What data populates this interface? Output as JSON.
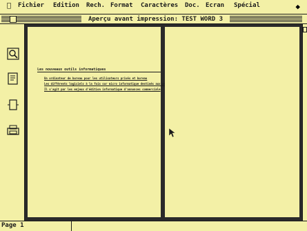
{
  "menubar": {
    "apple_icon": "apple-icon",
    "items": [
      "Fichier",
      "Edition",
      "Rech.",
      "Format",
      "Caractères",
      "Doc.",
      "Ecran",
      "Spécial"
    ],
    "right_icon": "balloon-help-icon"
  },
  "window": {
    "title": "Aperçu avant impression: TEST WORD 3"
  },
  "toolbar": {
    "icons": [
      "magnifier-icon",
      "margins-icon",
      "one-page-icon",
      "print-icon"
    ]
  },
  "document": {
    "heading": "Les nouveaux outils informatiques",
    "lines": [
      "Un ordinateur de bureau pour les utilisateurs privés et bureau",
      "Les différents logiciels à la fois sur micro informatique destinés aux professionnels",
      "Il s'agit par les enjeux d'édition informatique d'annonces commerciale"
    ]
  },
  "status": {
    "page": "Page 1"
  }
}
